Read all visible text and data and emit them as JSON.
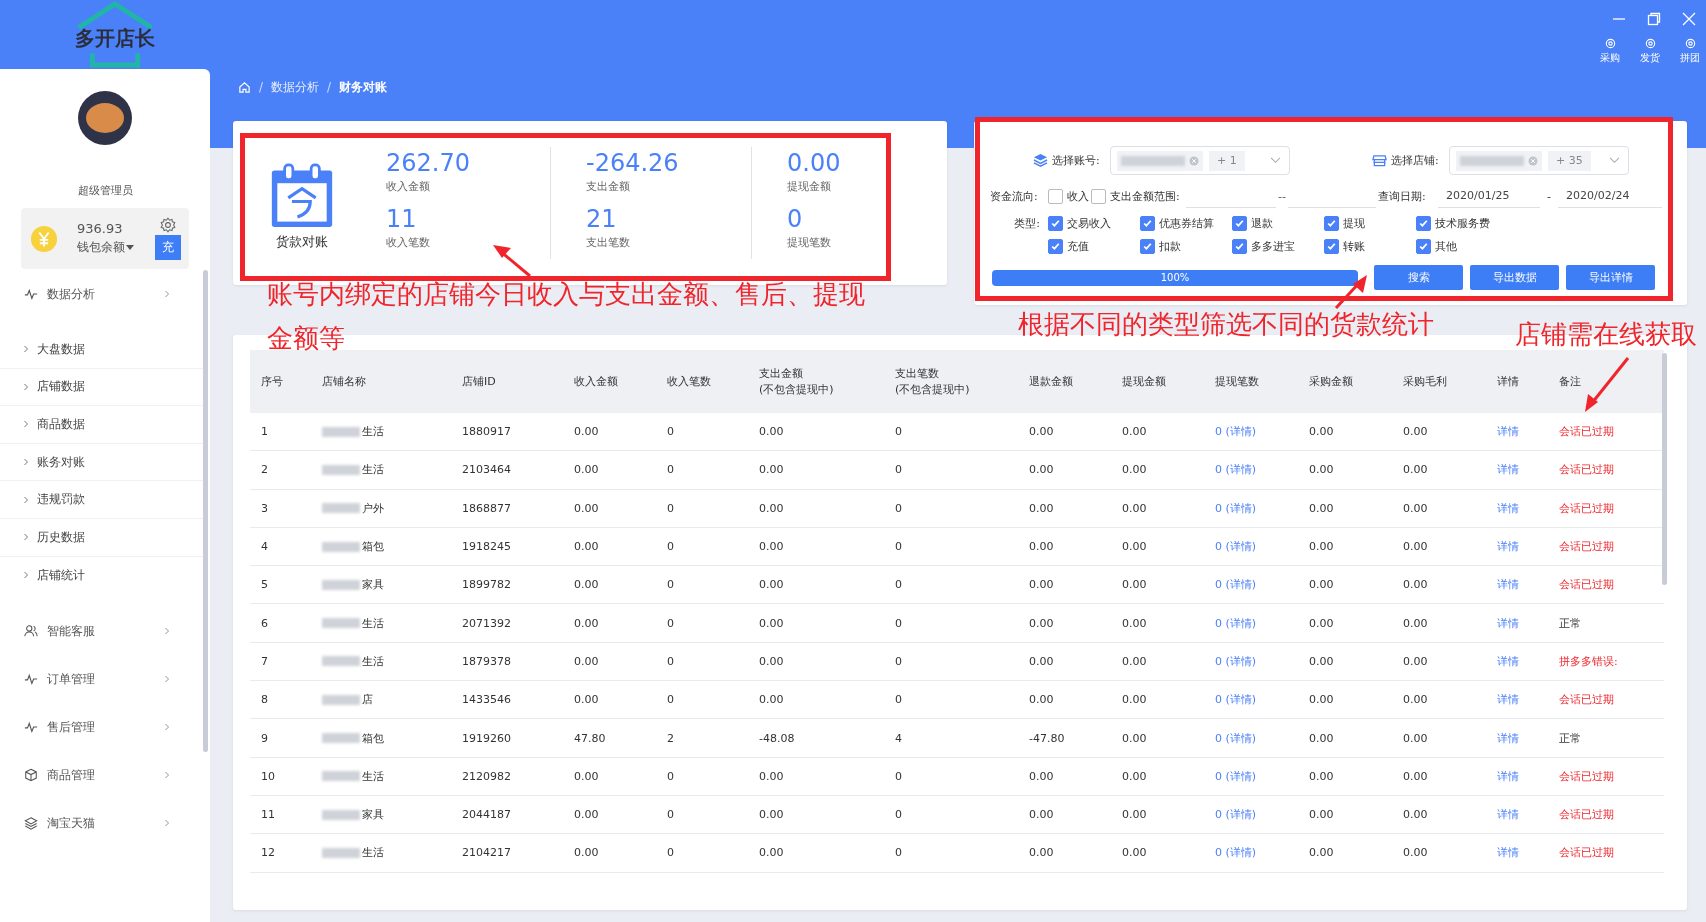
{
  "logo": "多开店长",
  "toolbar": [
    {
      "label": "采购"
    },
    {
      "label": "发货"
    },
    {
      "label": "拼团"
    }
  ],
  "breadcrumb": {
    "separator": "/",
    "items": [
      "数据分析",
      "财务对账"
    ]
  },
  "user": {
    "name": "超级管理员"
  },
  "wallet": {
    "amount": "936.93",
    "label": "钱包余额",
    "recharge": "充"
  },
  "menu": [
    {
      "label": "数据分析",
      "children": [
        {
          "label": "大盘数据"
        },
        {
          "label": "店铺数据"
        },
        {
          "label": "商品数据"
        },
        {
          "label": "账务对账"
        },
        {
          "label": "违规罚款"
        },
        {
          "label": "历史数据"
        },
        {
          "label": "店铺统计"
        }
      ]
    },
    {
      "label": "智能客服"
    },
    {
      "label": "订单管理"
    },
    {
      "label": "售后管理"
    },
    {
      "label": "商品管理"
    },
    {
      "label": "淘宝天猫"
    }
  ],
  "summary": {
    "title": "货款对账",
    "stats": [
      {
        "amount": "262.70",
        "amount_label": "收入金额",
        "count": "11",
        "count_label": "收入笔数"
      },
      {
        "amount": "-264.26",
        "amount_label": "支出金额",
        "count": "21",
        "count_label": "支出笔数"
      },
      {
        "amount": "0.00",
        "amount_label": "提现金额",
        "count": "0",
        "count_label": "提现笔数"
      }
    ]
  },
  "filters": {
    "account": {
      "label": "选择账号:",
      "more": "+ 1"
    },
    "shop": {
      "label": "选择店铺:",
      "more": "+ 35"
    },
    "flow": {
      "label": "资金流向:",
      "options": [
        {
          "label": "收入",
          "checked": false
        },
        {
          "label": "支出",
          "checked": false
        }
      ]
    },
    "amount_range": {
      "label": "金额范围:",
      "separator": "--"
    },
    "date": {
      "label": "查询日期:",
      "start": "2020/01/25",
      "separator": "-",
      "end": "2020/02/24"
    },
    "types": {
      "label": "类型:",
      "options": [
        {
          "label": "交易收入",
          "checked": true
        },
        {
          "label": "优惠券结算",
          "checked": true
        },
        {
          "label": "退款",
          "checked": true
        },
        {
          "label": "提现",
          "checked": true
        },
        {
          "label": "技术服务费",
          "checked": true
        },
        {
          "label": "充值",
          "checked": true
        },
        {
          "label": "扣款",
          "checked": true
        },
        {
          "label": "多多进宝",
          "checked": true
        },
        {
          "label": "转账",
          "checked": true
        },
        {
          "label": "其他",
          "checked": true
        }
      ]
    },
    "progress": {
      "level": 1,
      "text": "100%"
    },
    "buttons": [
      "搜索",
      "导出数据",
      "导出详情"
    ]
  },
  "table": {
    "columns": [
      {
        "label": "序号",
        "kind": "text"
      },
      {
        "label": "店铺名称",
        "kind": "name"
      },
      {
        "label": "店铺ID",
        "kind": "text"
      },
      {
        "label": "收入金额",
        "kind": "text"
      },
      {
        "label": "收入笔数",
        "kind": "text"
      },
      {
        "label": "支出金额",
        "note": "(不包含提现中)",
        "kind": "text"
      },
      {
        "label": "支出笔数",
        "note": "(不包含提现中)",
        "kind": "text"
      },
      {
        "label": "退款金额",
        "kind": "text"
      },
      {
        "label": "提现金额",
        "kind": "text"
      },
      {
        "label": "提现笔数",
        "kind": "link"
      },
      {
        "label": "采购金额",
        "kind": "text"
      },
      {
        "label": "采购毛利",
        "kind": "text"
      },
      {
        "label": "详情",
        "kind": "link"
      },
      {
        "label": "备注",
        "kind": "remark"
      }
    ],
    "rows": [
      {
        "cells": [
          "1",
          "生活",
          "1880917",
          "0.00",
          "0",
          "0.00",
          "0",
          "0.00",
          "0.00",
          "0 (详情)",
          "0.00",
          "0.00",
          "详情",
          "会话已过期"
        ],
        "alert": true
      },
      {
        "cells": [
          "2",
          "生活",
          "2103464",
          "0.00",
          "0",
          "0.00",
          "0",
          "0.00",
          "0.00",
          "0 (详情)",
          "0.00",
          "0.00",
          "详情",
          "会话已过期"
        ],
        "alert": true
      },
      {
        "cells": [
          "3",
          "户外",
          "1868877",
          "0.00",
          "0",
          "0.00",
          "0",
          "0.00",
          "0.00",
          "0 (详情)",
          "0.00",
          "0.00",
          "详情",
          "会话已过期"
        ],
        "alert": true
      },
      {
        "cells": [
          "4",
          "箱包",
          "1918245",
          "0.00",
          "0",
          "0.00",
          "0",
          "0.00",
          "0.00",
          "0 (详情)",
          "0.00",
          "0.00",
          "详情",
          "会话已过期"
        ],
        "alert": true
      },
      {
        "cells": [
          "5",
          "家具",
          "1899782",
          "0.00",
          "0",
          "0.00",
          "0",
          "0.00",
          "0.00",
          "0 (详情)",
          "0.00",
          "0.00",
          "详情",
          "会话已过期"
        ],
        "alert": true
      },
      {
        "cells": [
          "6",
          "生活",
          "2071392",
          "0.00",
          "0",
          "0.00",
          "0",
          "0.00",
          "0.00",
          "0 (详情)",
          "0.00",
          "0.00",
          "详情",
          "正常"
        ],
        "alert": false
      },
      {
        "cells": [
          "7",
          "生活",
          "1879378",
          "0.00",
          "0",
          "0.00",
          "0",
          "0.00",
          "0.00",
          "0 (详情)",
          "0.00",
          "0.00",
          "详情",
          "拼多多错误:"
        ],
        "alert": true
      },
      {
        "cells": [
          "8",
          "店",
          "1433546",
          "0.00",
          "0",
          "0.00",
          "0",
          "0.00",
          "0.00",
          "0 (详情)",
          "0.00",
          "0.00",
          "详情",
          "会话已过期"
        ],
        "alert": true
      },
      {
        "cells": [
          "9",
          "箱包",
          "1919260",
          "47.80",
          "2",
          "-48.08",
          "4",
          "-47.80",
          "0.00",
          "0 (详情)",
          "0.00",
          "0.00",
          "详情",
          "正常"
        ],
        "alert": false
      },
      {
        "cells": [
          "10",
          "生活",
          "2120982",
          "0.00",
          "0",
          "0.00",
          "0",
          "0.00",
          "0.00",
          "0 (详情)",
          "0.00",
          "0.00",
          "详情",
          "会话已过期"
        ],
        "alert": true
      },
      {
        "cells": [
          "11",
          "家具",
          "2044187",
          "0.00",
          "0",
          "0.00",
          "0",
          "0.00",
          "0.00",
          "0 (详情)",
          "0.00",
          "0.00",
          "详情",
          "会话已过期"
        ],
        "alert": true
      },
      {
        "cells": [
          "12",
          "生活",
          "2104217",
          "0.00",
          "0",
          "0.00",
          "0",
          "0.00",
          "0.00",
          "0 (详情)",
          "0.00",
          "0.00",
          "详情",
          "会话已过期"
        ],
        "alert": true
      }
    ]
  },
  "annotations": [
    "账号内绑定的店铺今日收入与支出金额、售后、提现金额等",
    "根据不同的类型筛选不同的货款统计",
    "店铺需在线获取"
  ]
}
